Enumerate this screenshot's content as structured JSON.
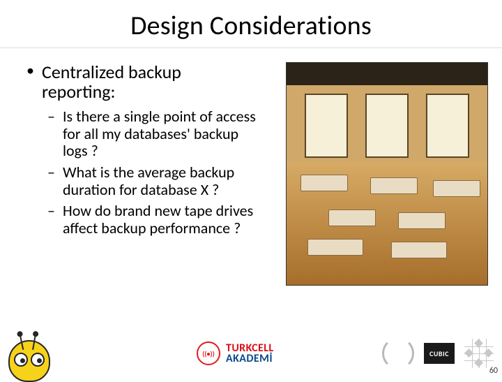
{
  "title": "Design Considerations",
  "bullets": {
    "lvl1": "Centralized backup reporting:",
    "lvl2": [
      "Is there a single point of access for all my databases' backup logs ?",
      "What is the average backup duration for database X ?",
      "How do brand new tape drives affect backup performance ?"
    ]
  },
  "footer": {
    "brand_line1": "TURKCELL",
    "brand_line2": "AKADEMİ",
    "cubic": "CUBIC"
  },
  "page_number": "60"
}
